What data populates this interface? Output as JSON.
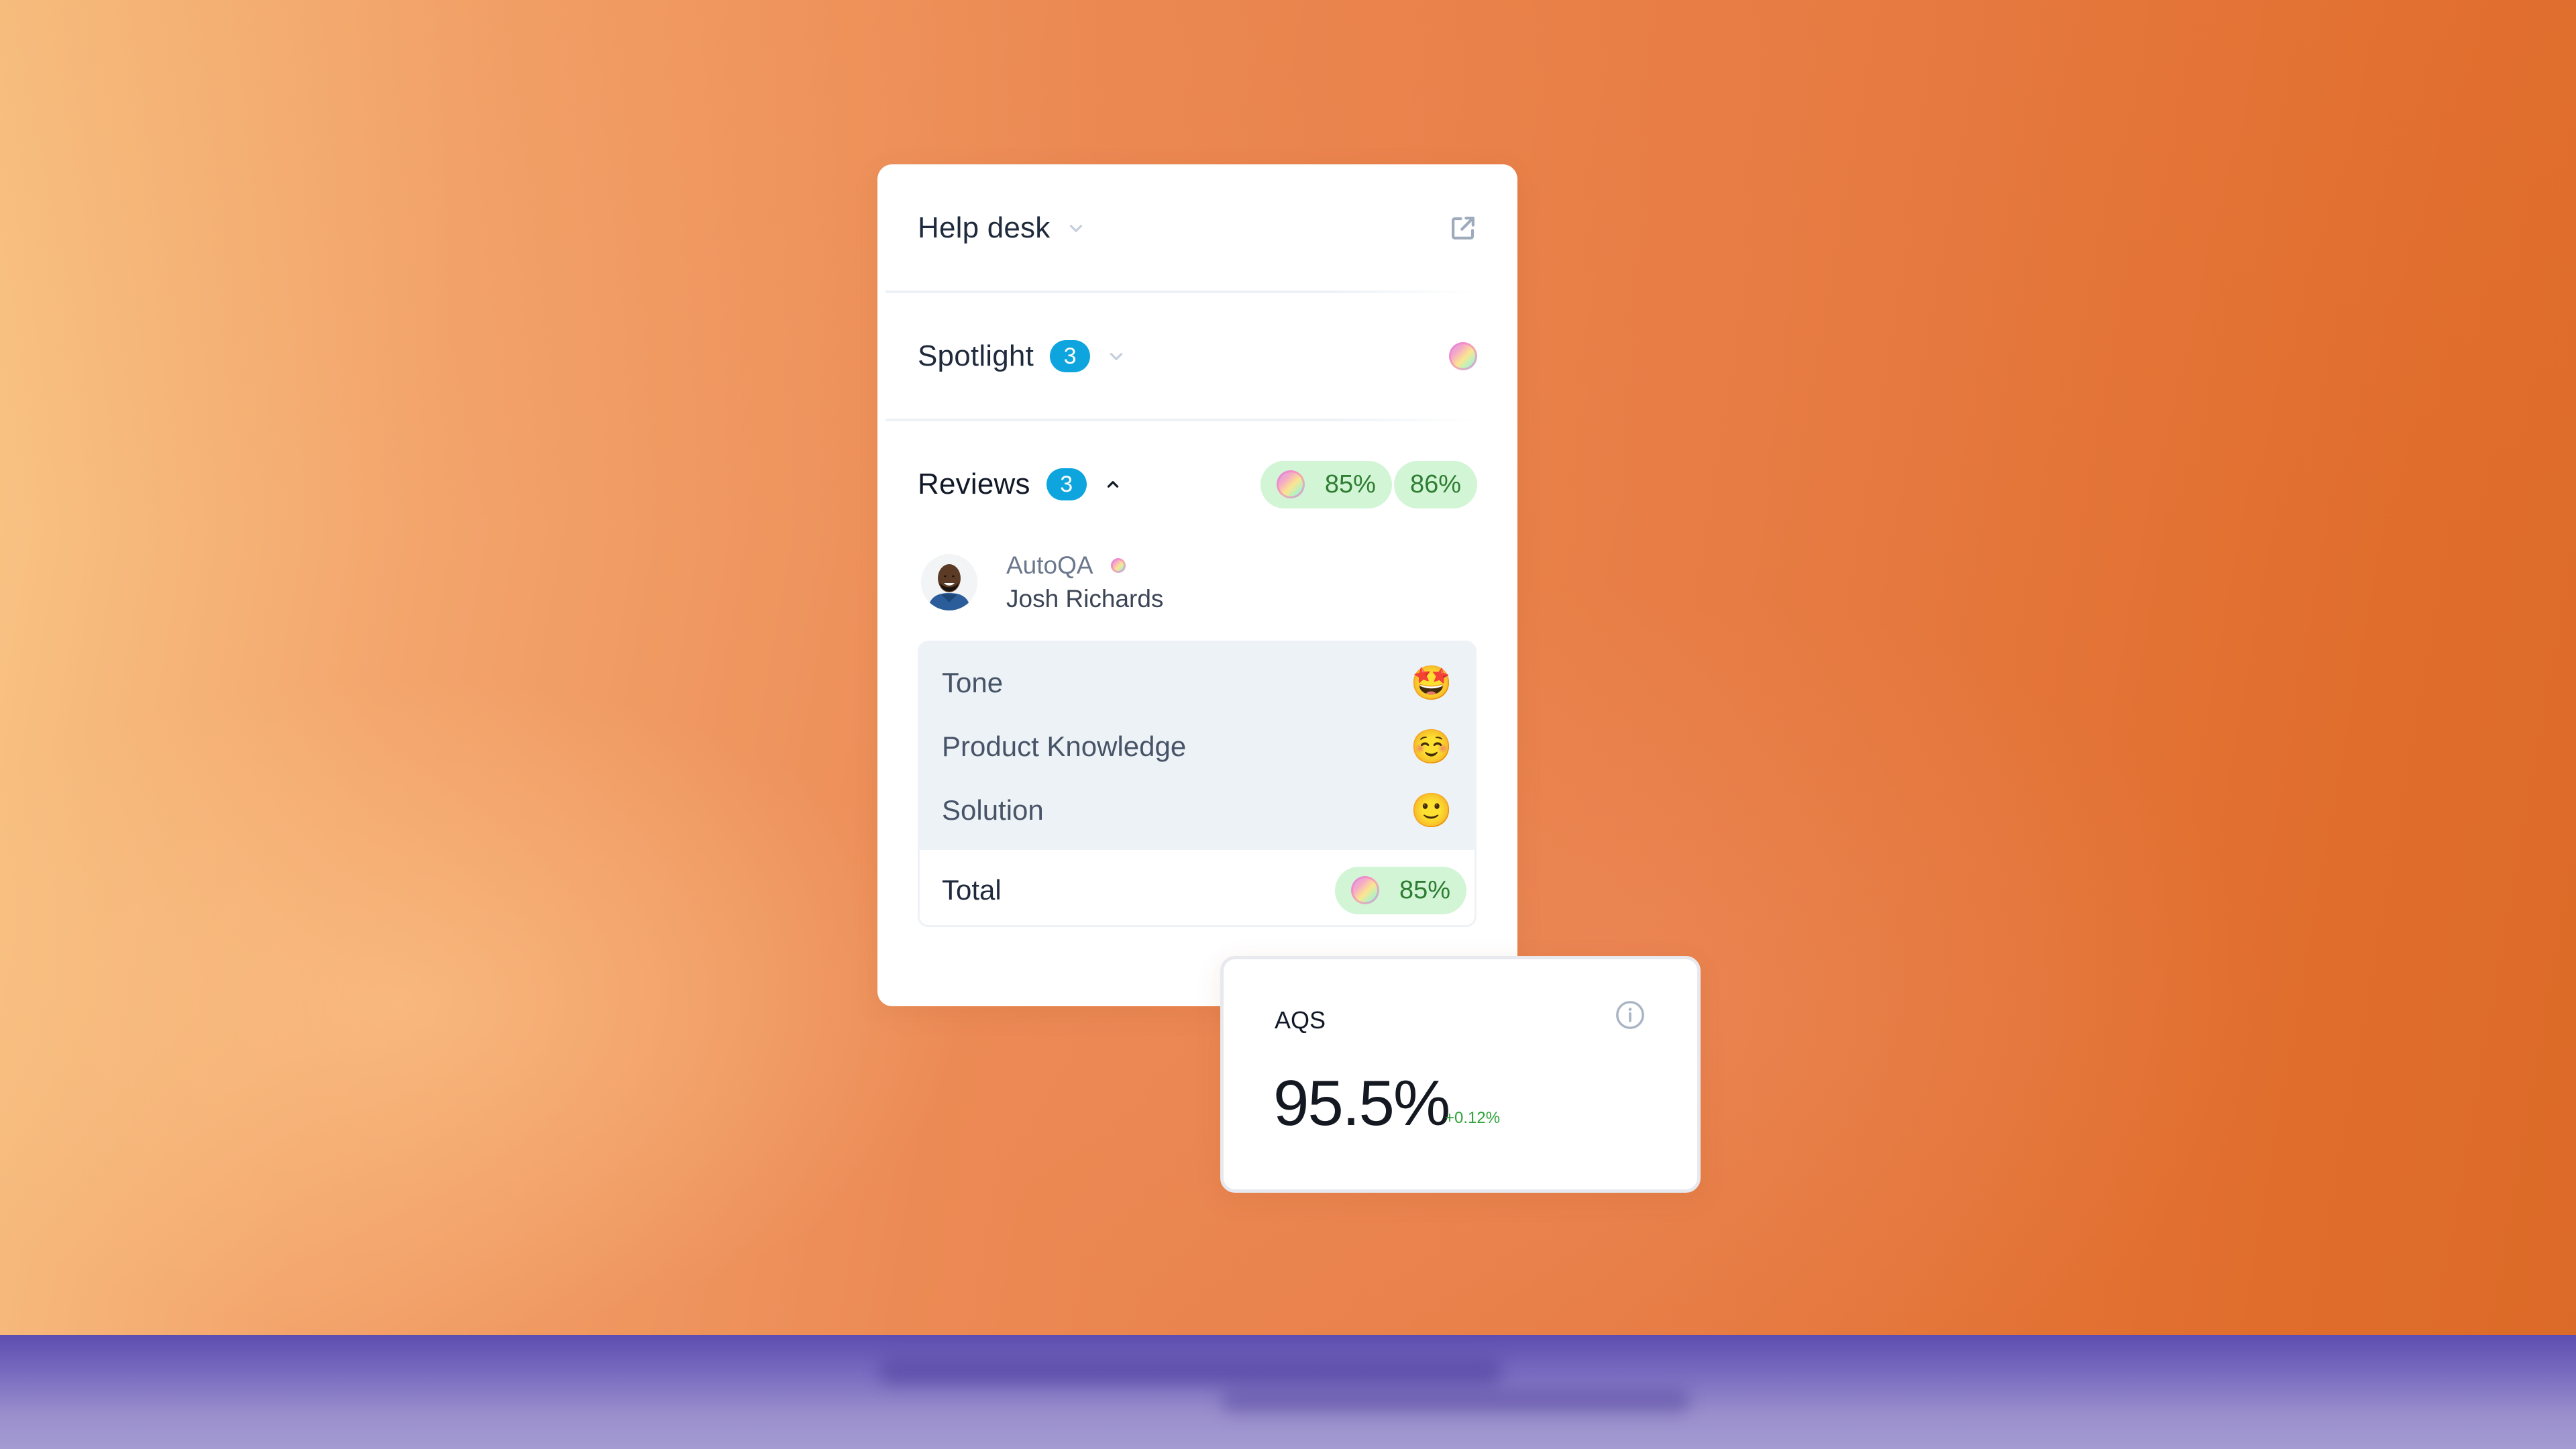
{
  "card": {
    "help_desk": {
      "label": "Help desk",
      "icon_chevron": "chevron-down-icon",
      "icon_action": "external-link-icon"
    },
    "spotlight": {
      "label": "Spotlight",
      "count": "3",
      "icon_chevron": "chevron-down-icon",
      "icon_status": "gradient-orb-icon"
    },
    "reviews": {
      "label": "Reviews",
      "count": "3",
      "icon_chevron": "chevron-up-icon",
      "scores": [
        {
          "value": "85%",
          "has_orb": true
        },
        {
          "value": "86%",
          "has_orb": false
        }
      ],
      "reviewer": {
        "source": "AutoQA",
        "name": "Josh Richards"
      },
      "criteria": [
        {
          "label": "Tone",
          "emoji": "🤩",
          "icon": "star-struck-emoji-icon"
        },
        {
          "label": "Product Knowledge",
          "emoji": "☺️",
          "icon": "smiling-blush-emoji-icon"
        },
        {
          "label": "Solution",
          "emoji": "🙂",
          "icon": "slight-smile-emoji-icon"
        }
      ],
      "total": {
        "label": "Total",
        "value": "85%"
      }
    }
  },
  "aqs": {
    "title": "AQS",
    "value": "95.5%",
    "delta": "+0.12%",
    "info_icon": "info-icon"
  },
  "colors": {
    "badge": "#0ea5df",
    "score_pill_bg": "#d2f5d6",
    "score_pill_text": "#2e7d32",
    "delta_positive": "#2fa33a"
  }
}
